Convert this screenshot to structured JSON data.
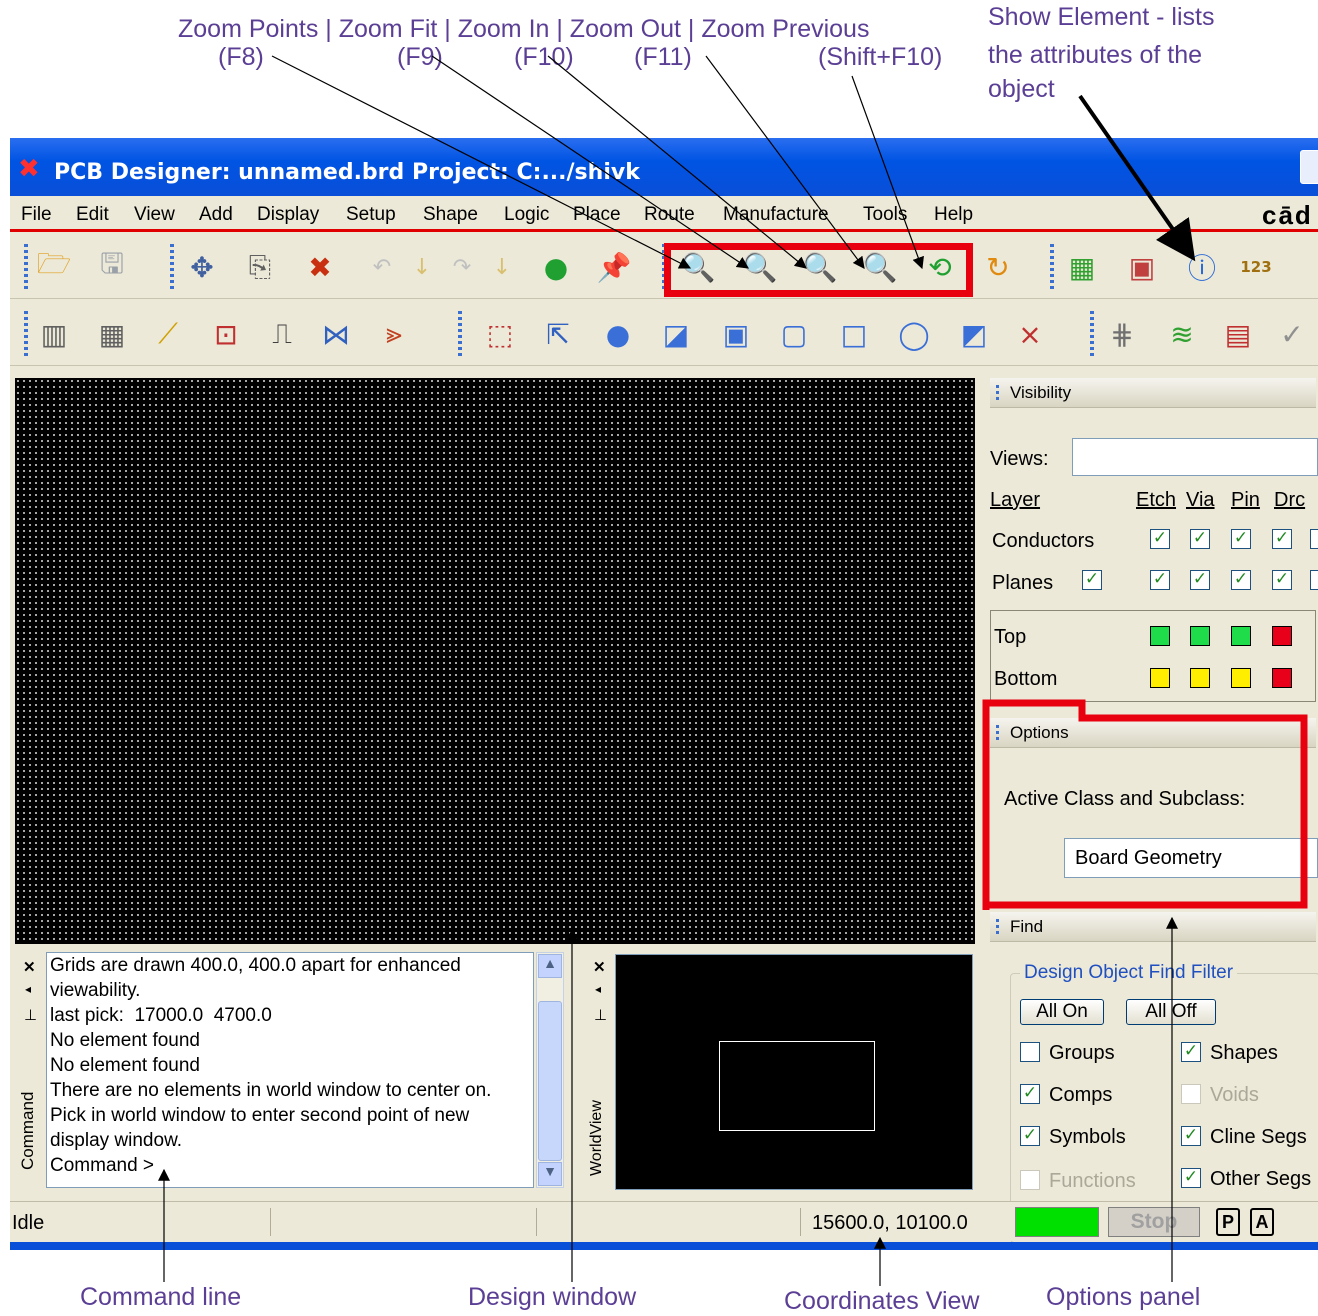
{
  "callouts": {
    "zoom_line1": "Zoom Points | Zoom Fit | Zoom In | Zoom Out | Zoom Previous",
    "f8": "(F8)",
    "f9": "(F9)",
    "f10": "(F10)",
    "f11": "(F11)",
    "shift_f10": "(Shift+F10)",
    "show_element_1": "Show Element - lists",
    "show_element_2": "the attributes of the",
    "show_element_3": "object",
    "command_line": "Command line",
    "design_window": "Design window",
    "coordinates_view": "Coordinates View",
    "options_panel": "Options panel"
  },
  "window": {
    "title": "PCB Designer: unnamed.brd  Project: C:.../shivk",
    "brand_fragment": "cād"
  },
  "menu": [
    "File",
    "Edit",
    "View",
    "Add",
    "Display",
    "Setup",
    "Shape",
    "Logic",
    "Place",
    "Route",
    "Manufacture",
    "Tools",
    "Help"
  ],
  "visibility": {
    "header": "Visibility",
    "views_label": "Views:",
    "layer_label": "Layer",
    "columns": [
      "Etch",
      "Via",
      "Pin",
      "Drc"
    ],
    "rows": {
      "conductors": "Conductors",
      "planes": "Planes",
      "top": "Top",
      "bottom": "Bottom"
    }
  },
  "options": {
    "header": "Options",
    "active_class_label": "Active Class and Subclass:",
    "active_class_value": "Board Geometry"
  },
  "find": {
    "header": "Find",
    "group_title": "Design Object Find Filter",
    "all_on": "All On",
    "all_off": "All Off",
    "items": {
      "groups": "Groups",
      "shapes": "Shapes",
      "comps": "Comps",
      "voids": "Voids",
      "symbols": "Symbols",
      "cline_segs": "Cline Segs",
      "functions": "Functions",
      "other_segs": "Other Segs"
    }
  },
  "command": {
    "tab_label": "Command",
    "text": "Grids are drawn 400.0, 400.0 apart for enhanced\nviewability.\nlast pick:  17000.0  4700.0\nNo element found\nNo element found\nThere are no elements in world window to center on.\nPick in world window to enter second point of new\ndisplay window.\nCommand >"
  },
  "worldview": {
    "tab_label": "WorldView"
  },
  "status": {
    "state": "Idle",
    "coordinates": "15600.0, 10100.0",
    "stop_label": "Stop",
    "p_label": "P",
    "a_label": "A",
    "indicator_color": "#00e000"
  },
  "colors": {
    "annotation": "#5b3f95",
    "highlight": "#e8000f",
    "swatch_green": "#1fdc4a",
    "swatch_yellow": "#ffee00",
    "swatch_red": "#e8001a"
  }
}
